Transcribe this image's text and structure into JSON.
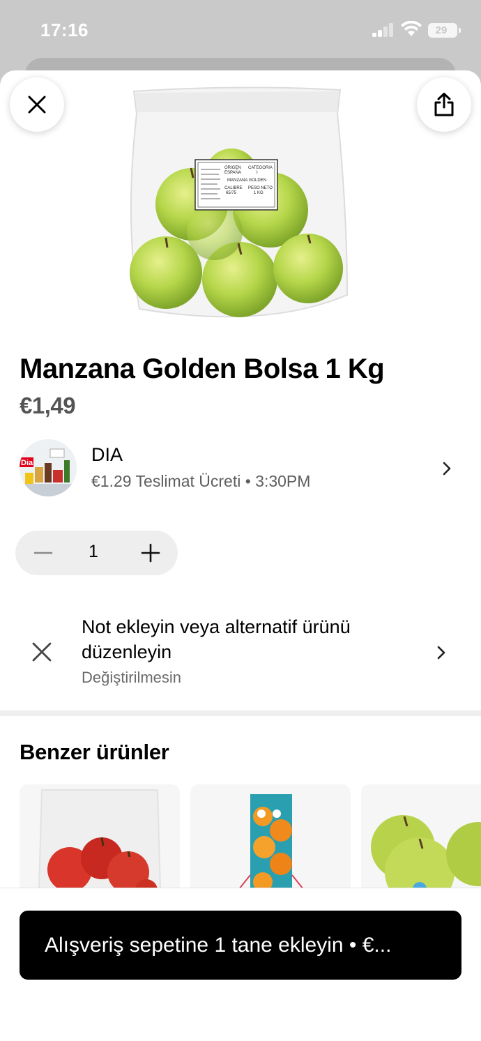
{
  "status_bar": {
    "time": "17:16",
    "battery": "29"
  },
  "product": {
    "title": "Manzana Golden Bolsa 1 Kg",
    "price": "€1,49",
    "label_lines": [
      "ORIGEN",
      "ESPAÑA",
      "CATEGORIA",
      "I",
      "MANZANA GOLDEN",
      "CALIBRE",
      "65/75",
      "PESO NETO",
      "1 KG"
    ]
  },
  "store": {
    "name": "DIA",
    "meta": "€1.29 Teslimat Ücreti • 3:30PM",
    "logo_text": "Dia"
  },
  "quantity": {
    "value": "1"
  },
  "note": {
    "title": "Not ekleyin veya alternatif ürünü düzenleyin",
    "subtitle": "Değiştirilmesin"
  },
  "similar": {
    "title": "Benzer ürünler"
  },
  "cta": {
    "label": "Alışveriş sepetine 1 tane ekleyin  • €..."
  },
  "icons": {
    "close": "close-icon",
    "share": "share-icon",
    "chevron": "chevron-right-icon",
    "minus": "minus-icon",
    "plus": "plus-icon"
  },
  "colors": {
    "cta_bg": "#000000",
    "price": "#545454",
    "apple_green": "#b5d64a"
  }
}
